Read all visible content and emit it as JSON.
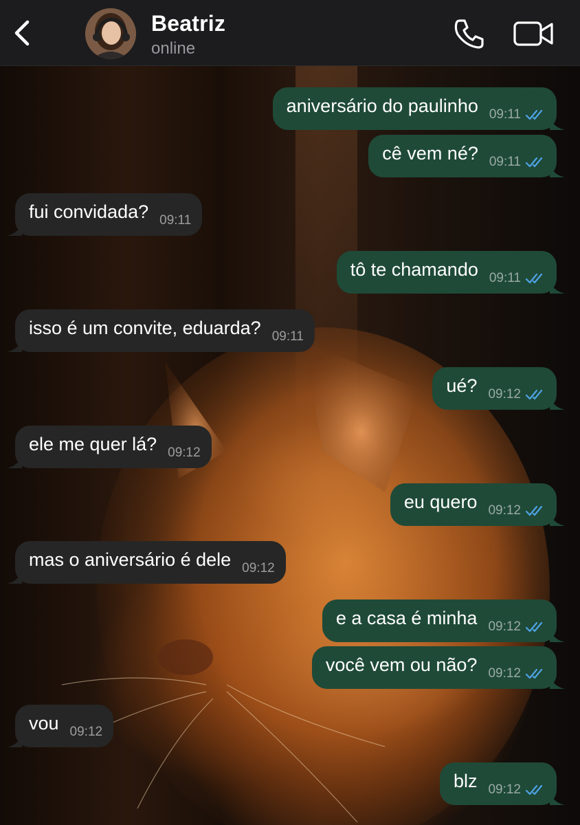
{
  "header": {
    "contact_name": "Beatriz",
    "status": "online",
    "back_icon": "chevron-left-icon",
    "call_icon": "phone-icon",
    "video_icon": "video-camera-icon"
  },
  "colors": {
    "header_bg": "#1c1c1e",
    "outgoing_bubble": "#1f4a38",
    "incoming_bubble": "#262626",
    "read_ticks": "#4fa3e6"
  },
  "messages": [
    {
      "direction": "out",
      "text": "aniversário do paulinho",
      "time": "09:11",
      "status": "read"
    },
    {
      "direction": "out",
      "text": "cê vem né?",
      "time": "09:11",
      "status": "read"
    },
    {
      "direction": "in",
      "text": "fui convidada?",
      "time": "09:11"
    },
    {
      "direction": "out",
      "text": "tô te chamando",
      "time": "09:11",
      "status": "read"
    },
    {
      "direction": "in",
      "text": "isso é um convite, eduarda?",
      "time": "09:11"
    },
    {
      "direction": "out",
      "text": "ué?",
      "time": "09:12",
      "status": "read"
    },
    {
      "direction": "in",
      "text": "ele me quer lá?",
      "time": "09:12"
    },
    {
      "direction": "out",
      "text": "eu quero",
      "time": "09:12",
      "status": "read"
    },
    {
      "direction": "in",
      "text": "mas o aniversário é dele",
      "time": "09:12"
    },
    {
      "direction": "out",
      "text": "e a casa é minha",
      "time": "09:12",
      "status": "read"
    },
    {
      "direction": "out",
      "text": "você vem ou não?",
      "time": "09:12",
      "status": "read"
    },
    {
      "direction": "in",
      "text": "vou",
      "time": "09:12"
    },
    {
      "direction": "out",
      "text": "blz",
      "time": "09:12",
      "status": "read"
    }
  ]
}
